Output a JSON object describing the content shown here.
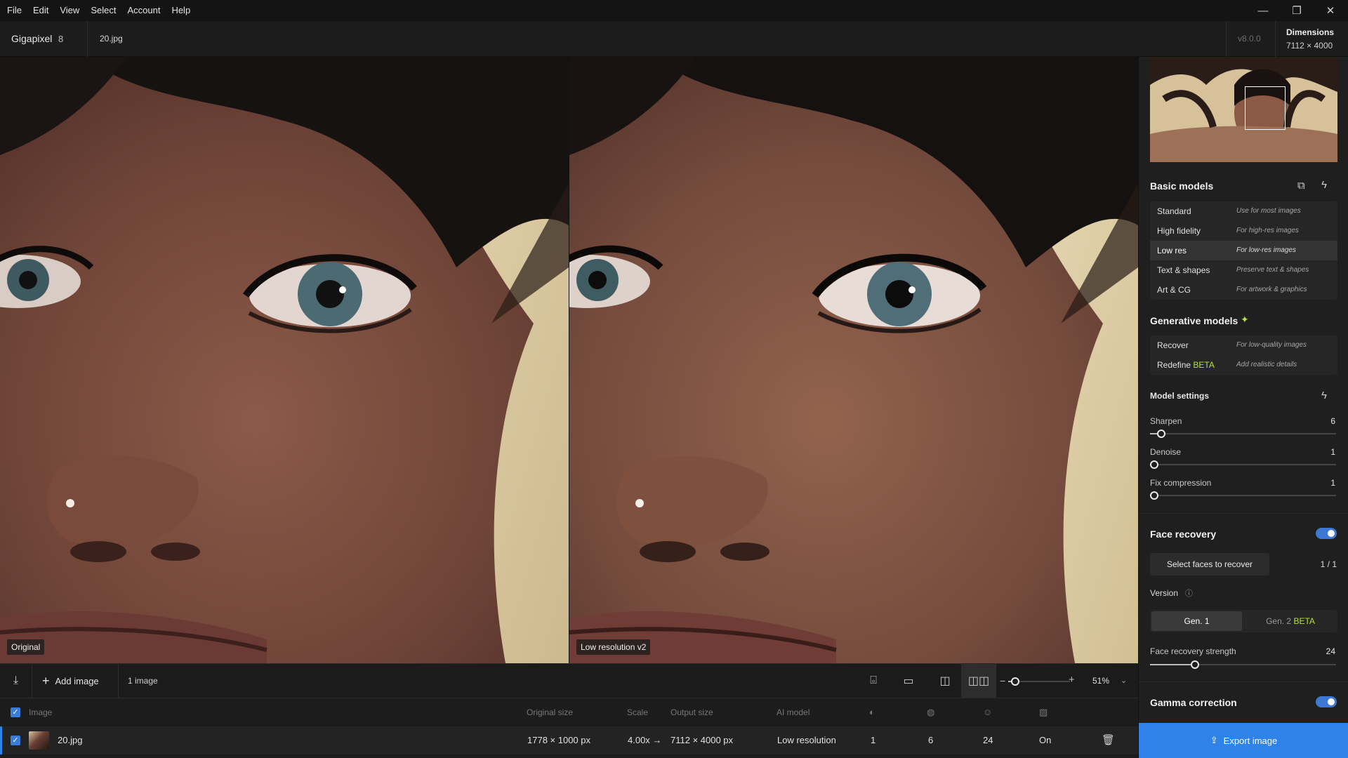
{
  "menu": [
    "File",
    "Edit",
    "View",
    "Select",
    "Account",
    "Help"
  ],
  "window_controls": {
    "minimize": "—",
    "restore": "❐",
    "close": "✕"
  },
  "titlebar": {
    "app_name": "Gigapixel",
    "app_version_major": "8",
    "file_name": "20.jpg",
    "version": "v8.0.0",
    "dimensions_label": "Dimensions",
    "dimensions_value": "7112 × 4000"
  },
  "viewer": {
    "left_label": "Original",
    "right_label": "Low resolution v2"
  },
  "toolbar": {
    "add_image": "Add image",
    "image_count": "1 image",
    "zoom": "51%"
  },
  "table": {
    "headers": {
      "image": "Image",
      "original_size": "Original size",
      "scale": "Scale",
      "output_size": "Output size",
      "ai_model": "AI model"
    },
    "rows": [
      {
        "name": "20.jpg",
        "original_size": "1778 × 1000 px",
        "scale": "4.00x →",
        "output_size": "7112 × 4000 px",
        "ai_model": "Low resolution",
        "col1": "1",
        "col2": "6",
        "col3": "24",
        "col4": "On"
      }
    ]
  },
  "panel": {
    "basic_models_title": "Basic models",
    "basic_models": [
      {
        "name": "Standard",
        "desc": "Use for most images"
      },
      {
        "name": "High fidelity",
        "desc": "For high-res images"
      },
      {
        "name": "Low res",
        "desc": "For low-res images"
      },
      {
        "name": "Text & shapes",
        "desc": "Preserve text & shapes"
      },
      {
        "name": "Art & CG",
        "desc": "For artwork & graphics"
      }
    ],
    "generative_models_title": "Generative models",
    "generative_models": [
      {
        "name": "Recover",
        "desc": "For low-quality images"
      },
      {
        "name": "Redefine",
        "beta": "BETA",
        "desc": "Add realistic details"
      }
    ],
    "model_settings_title": "Model settings",
    "sliders": {
      "sharpen": {
        "label": "Sharpen",
        "value": "6"
      },
      "denoise": {
        "label": "Denoise",
        "value": "1"
      },
      "fix_compression": {
        "label": "Fix compression",
        "value": "1"
      }
    },
    "face_recovery_title": "Face recovery",
    "select_faces": "Select faces to recover",
    "faces_count": "1 / 1",
    "version_label": "Version",
    "gen1": "Gen. 1",
    "gen2": "Gen. 2",
    "gen2_beta": "BETA",
    "face_strength": {
      "label": "Face recovery strength",
      "value": "24"
    },
    "gamma_title": "Gamma correction",
    "export": "Export image"
  },
  "colors": {
    "accent": "#2f82e8",
    "beta": "#b3e23a"
  }
}
